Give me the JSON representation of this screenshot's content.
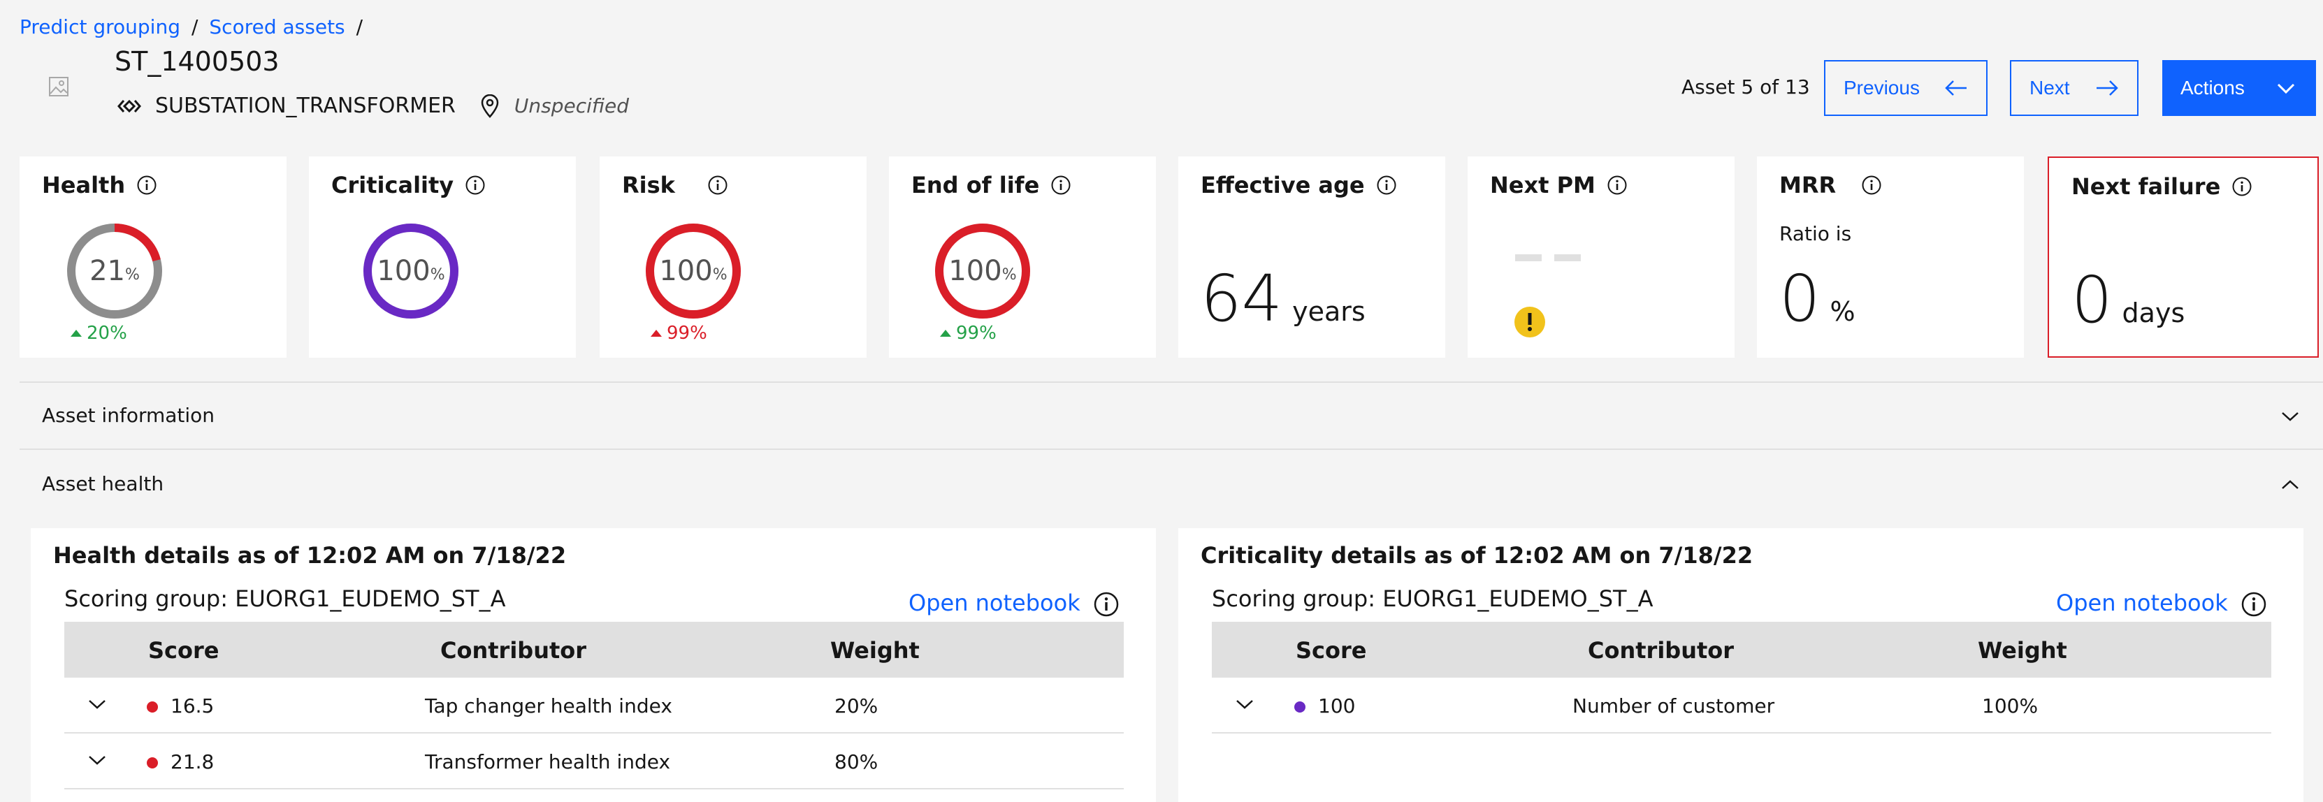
{
  "breadcrumb": {
    "items": [
      "Predict grouping",
      "Scored assets"
    ],
    "separator": "/"
  },
  "asset": {
    "name": "ST_1400503",
    "type": "SUBSTATION_TRANSFORMER",
    "location": "Unspecified"
  },
  "pager": {
    "label": "Asset 5 of 13",
    "previous": "Previous",
    "next": "Next",
    "actions": "Actions"
  },
  "kpis": {
    "health": {
      "title": "Health",
      "value": "21",
      "unit": "%",
      "fraction": 0.21,
      "trend": "20%",
      "color": "#da1e28"
    },
    "criticality": {
      "title": "Criticality",
      "value": "100",
      "unit": "%",
      "fraction": 1.0,
      "color": "#6929c4"
    },
    "risk": {
      "title": "Risk",
      "value": "100",
      "unit": "%",
      "fraction": 1.0,
      "trend": "99%",
      "color": "#da1e28"
    },
    "end_of_life": {
      "title": "End of life",
      "value": "100",
      "unit": "%",
      "fraction": 1.0,
      "trend": "99%",
      "color": "#da1e28"
    },
    "effective_age": {
      "title": "Effective age",
      "value": "64",
      "unit": "years"
    },
    "next_pm": {
      "title": "Next PM"
    },
    "mrr": {
      "title": "MRR",
      "ratio_label": "Ratio is",
      "value": "0",
      "unit": "%"
    },
    "next_failure": {
      "title": "Next failure",
      "value": "0",
      "unit": "days"
    }
  },
  "accordions": {
    "asset_information": "Asset information",
    "asset_health": "Asset health"
  },
  "health_details": {
    "title": "Health details as of 12:02 AM on 7/18/22",
    "scoring_group": "Scoring group:  EUORG1_EUDEMO_ST_A",
    "open_notebook": "Open notebook",
    "headers": [
      "Score",
      "Contributor",
      "Weight"
    ],
    "rows": [
      {
        "score": "16.5",
        "contributor": "Tap changer health index",
        "weight": "20%",
        "dot_color": "#da1e28"
      },
      {
        "score": "21.8",
        "contributor": "Transformer health index",
        "weight": "80%",
        "dot_color": "#da1e28"
      }
    ]
  },
  "criticality_details": {
    "title": "Criticality details as of 12:02 AM on 7/18/22",
    "scoring_group": "Scoring group:  EUORG1_EUDEMO_ST_A",
    "open_notebook": "Open notebook",
    "headers": [
      "Score",
      "Contributor",
      "Weight"
    ],
    "rows": [
      {
        "score": "100",
        "contributor": "Number of customer",
        "weight": "100%",
        "dot_color": "#6929c4"
      }
    ]
  },
  "colors": {
    "accent": "#0f62fe",
    "danger": "#da1e28",
    "success": "#24a148",
    "warning": "#f1c21b",
    "purple": "#6929c4"
  }
}
